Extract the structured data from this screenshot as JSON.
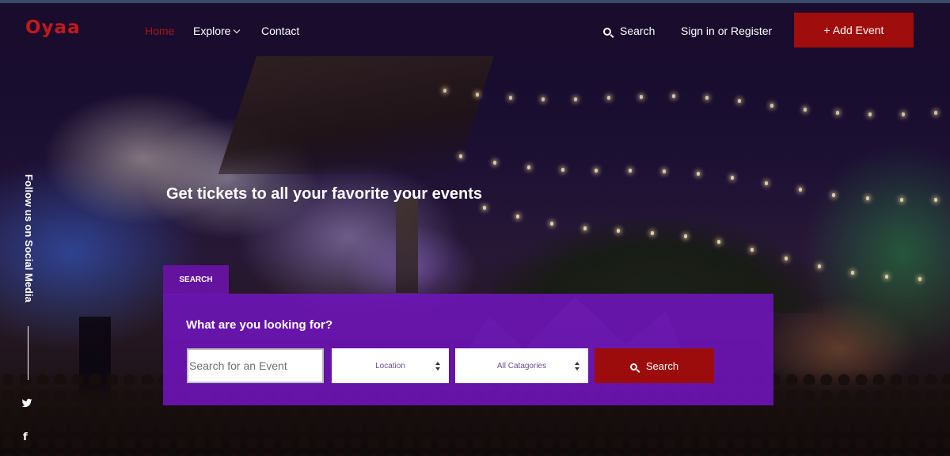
{
  "header": {
    "logo_text": "Oyaa",
    "nav": {
      "home": "Home",
      "explore": "Explore",
      "contact": "Contact",
      "search": "Search",
      "signin": "Sign in or Register"
    },
    "add_event_label": "+ Add Event"
  },
  "social": {
    "rail_text": "Follow us on Social Media",
    "twitter_icon": "twitter-icon",
    "facebook_icon": "facebook-icon",
    "facebook_glyph": "f"
  },
  "hero": {
    "title": "Get tickets to all your favorite your events"
  },
  "search": {
    "tab_label": "SEARCH",
    "panel_title": "What are you looking for?",
    "input_placeholder": "Search for an Event",
    "location_selected": "Location",
    "category_selected": "All Catagories",
    "button_label": "Search"
  },
  "colors": {
    "brand_red": "#a00d0d",
    "active_nav": "#a8121a",
    "panel_purple": "#7014bc",
    "navbar": "#1a0c2e"
  }
}
